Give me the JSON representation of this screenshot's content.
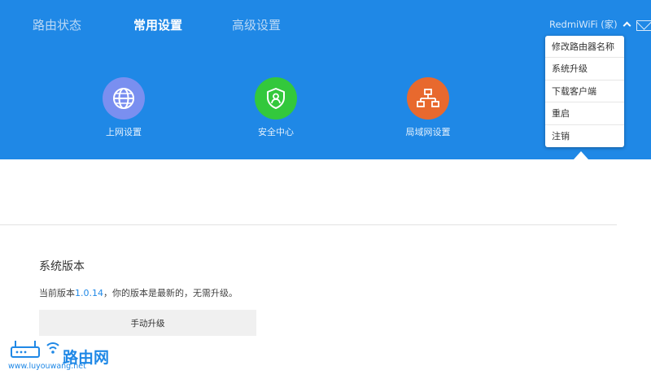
{
  "nav": {
    "items": [
      {
        "label": "路由状态",
        "active": false
      },
      {
        "label": "常用设置",
        "active": true
      },
      {
        "label": "高级设置",
        "active": false
      }
    ]
  },
  "account": {
    "label": "RedmiWiFi (家)",
    "chevron": "chevron-up-icon",
    "mail": "mail-icon"
  },
  "tiles": [
    {
      "label": "上网设置",
      "icon": "globe-icon",
      "color": "#7a8ff0"
    },
    {
      "label": "安全中心",
      "icon": "shield-user-icon",
      "color": "#33c83c"
    },
    {
      "label": "局域网设置",
      "icon": "network-icon",
      "color": "#e8692e"
    }
  ],
  "dropdown": {
    "items": [
      {
        "label": "修改路由器名称"
      },
      {
        "label": "系统升级"
      },
      {
        "label": "下载客户端"
      },
      {
        "label": "重启"
      },
      {
        "label": "注销"
      }
    ]
  },
  "main": {
    "section_title": "系统版本",
    "version_prefix": "当前版本",
    "version": "1.0.14",
    "version_suffix": "，你的版本是最新的，无需升级。",
    "upgrade_button": "手动升级"
  },
  "watermark": {
    "text": "路由网",
    "url": "www.luyouwang.net"
  },
  "colors": {
    "banner": "#1f88e6",
    "link": "#1f88e6"
  }
}
